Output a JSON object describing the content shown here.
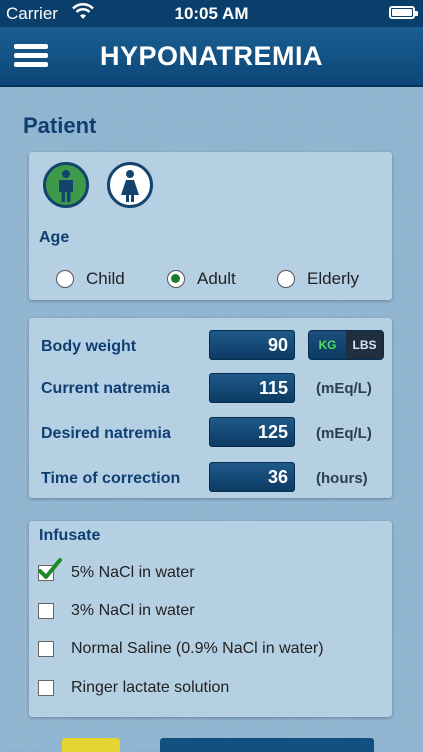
{
  "status": {
    "carrier": "Carrier",
    "time": "10:05 AM"
  },
  "nav": {
    "title": "HYPONATREMIA"
  },
  "patient": {
    "title": "Patient",
    "age_label": "Age",
    "age_options": [
      "Child",
      "Adult",
      "Elderly"
    ],
    "age_selected": "Adult",
    "gender_selected": "male"
  },
  "measures": {
    "body_weight": {
      "label": "Body weight",
      "value": "90"
    },
    "unit_toggle": {
      "kg": "KG",
      "lbs": "LBS",
      "selected": "KG"
    },
    "current_natremia": {
      "label": "Current natremia",
      "value": "115",
      "unit": "(mEq/L)"
    },
    "desired_natremia": {
      "label": "Desired natremia",
      "value": "125",
      "unit": "(mEq/L)"
    },
    "time_of_correction": {
      "label": "Time of correction",
      "value": "36",
      "unit": "(hours)"
    }
  },
  "infusate": {
    "title": "Infusate",
    "items": [
      {
        "label": "5% NaCl in water",
        "checked": true
      },
      {
        "label": "3% NaCl in water",
        "checked": false
      },
      {
        "label": "Normal Saline (0.9% NaCl in water)",
        "checked": false
      },
      {
        "label": "Ringer lactate solution",
        "checked": false
      }
    ]
  },
  "colors": {
    "navbar": "#0d4677",
    "accent_green": "#3e9a4a",
    "card": "#b5cfe3",
    "label_blue": "#0f3f72"
  }
}
